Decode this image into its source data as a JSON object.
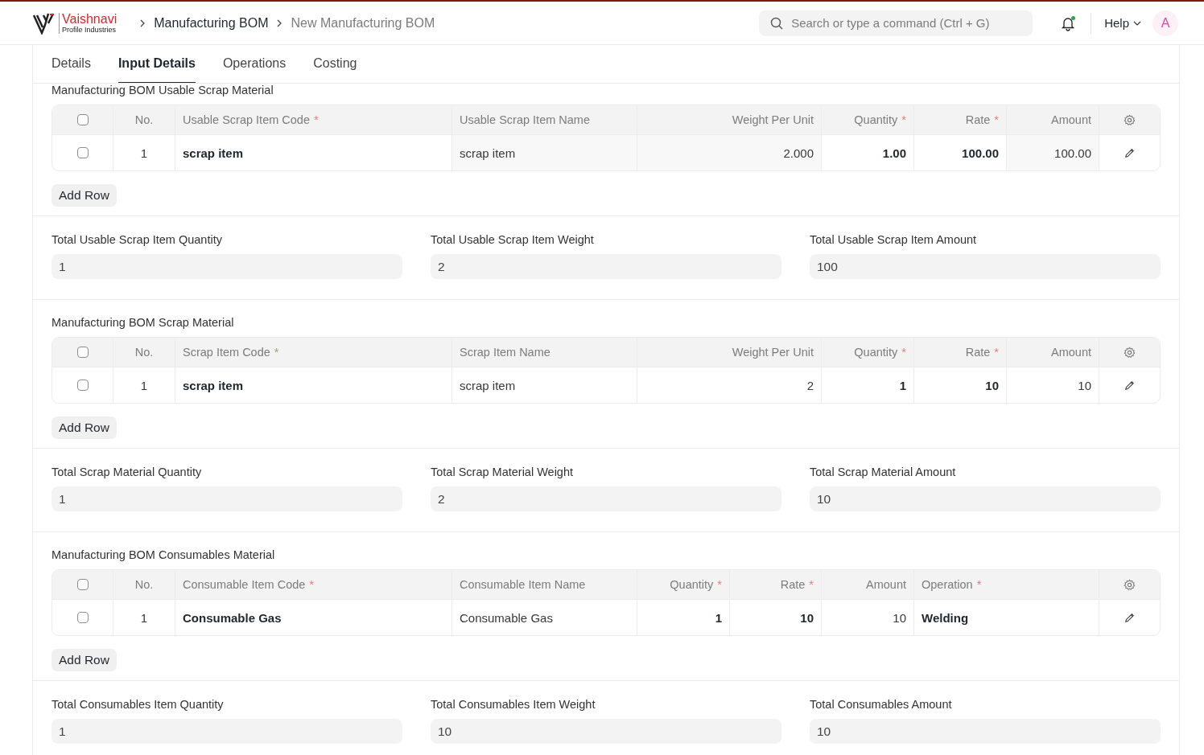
{
  "navbar": {
    "logo_name": "Vaishnavi",
    "logo_tagline": "Profile Industries",
    "breadcrumbs": [
      {
        "label": "Manufacturing BOM",
        "current": false
      },
      {
        "label": "New Manufacturing BOM",
        "current": true
      }
    ],
    "search": {
      "placeholder": "Search or type a command (Ctrl + G)"
    },
    "notifications_unread": true,
    "help": "Help",
    "avatar": "A"
  },
  "tabs": [
    {
      "label": "Details",
      "selected": false
    },
    {
      "label": "Input Details",
      "selected": true
    },
    {
      "label": "Operations",
      "selected": false
    },
    {
      "label": "Costing",
      "selected": false
    }
  ],
  "sections": [
    {
      "title": "Manufacturing BOM Usable Scrap Material",
      "table": {
        "all_checked": false,
        "columns": [
          {
            "label": "No.",
            "kind": "index"
          },
          {
            "label": "Usable Scrap Item Code",
            "marker": "*",
            "kind": "input"
          },
          {
            "label": "Usable Scrap Item Name",
            "kind": "readonly"
          },
          {
            "label": "Weight Per Unit",
            "kind": "readonlynumber"
          },
          {
            "label": "Quantity",
            "marker": "*",
            "kind": "inputnumber"
          },
          {
            "label": "Rate",
            "marker": "*",
            "kind": "inputnumber"
          },
          {
            "label": "Amount",
            "kind": "readonlynumber"
          }
        ],
        "rows": [
          {
            "checked": false,
            "cells": [
              "1",
              "scrap item",
              "scrap item",
              "2.000",
              "1.00",
              "100.00",
              "100.00"
            ]
          }
        ]
      },
      "add_row": "Add Row",
      "totals": [
        {
          "label": "Total Usable Scrap Item Quantity",
          "value": "1"
        },
        {
          "label": "Total Usable Scrap Item Weight",
          "value": "2"
        },
        {
          "label": "Total Usable Scrap Item Amount",
          "value": "100"
        }
      ]
    },
    {
      "title": "Manufacturing BOM Scrap Material",
      "table": {
        "all_checked": false,
        "columns": [
          {
            "label": "No.",
            "kind": "index"
          },
          {
            "label": "Scrap Item Code",
            "marker": "*",
            "kind": "input"
          },
          {
            "label": "Scrap Item Name",
            "kind": "text"
          },
          {
            "label": "Weight Per Unit",
            "kind": "number"
          },
          {
            "label": "Quantity",
            "marker": "*",
            "kind": "inputnumber"
          },
          {
            "label": "Rate",
            "marker": "*",
            "kind": "inputnumber"
          },
          {
            "label": "Amount",
            "kind": "number"
          }
        ],
        "rows": [
          {
            "checked": false,
            "cells": [
              "1",
              "scrap item",
              "scrap item",
              "2",
              "1",
              "10",
              "10"
            ]
          }
        ]
      },
      "add_row": "Add Row",
      "totals": [
        {
          "label": "Total Scrap Material Quantity",
          "value": "1"
        },
        {
          "label": "Total Scrap Material Weight",
          "value": "2"
        },
        {
          "label": "Total Scrap Material Amount",
          "value": "10"
        }
      ]
    },
    {
      "title": "Manufacturing BOM Consumables Material",
      "table": {
        "all_checked": false,
        "columns": [
          {
            "label": "No.",
            "kind": "index"
          },
          {
            "label": "Consumable Item Code",
            "marker": "*",
            "kind": "input"
          },
          {
            "label": "Consumable Item Name",
            "kind": "text"
          },
          {
            "label": "Quantity",
            "marker": "*",
            "kind": "inputnumber"
          },
          {
            "label": "Rate",
            "marker": "*",
            "kind": "inputnumber"
          },
          {
            "label": "Amount",
            "kind": "number"
          },
          {
            "label": "Operation",
            "marker": "*",
            "kind": "input"
          }
        ],
        "rows": [
          {
            "checked": false,
            "cells": [
              "1",
              "Consumable Gas",
              "Consumable Gas",
              "1",
              "10",
              "10",
              "Welding"
            ]
          }
        ]
      },
      "add_row": "Add Row",
      "totals": [
        {
          "label": "Total Consumables Item Quantity",
          "value": "1"
        },
        {
          "label": "Total Consumables Item Weight",
          "value": "10"
        },
        {
          "label": "Total Consumables Amount",
          "value": "10"
        }
      ]
    }
  ]
}
